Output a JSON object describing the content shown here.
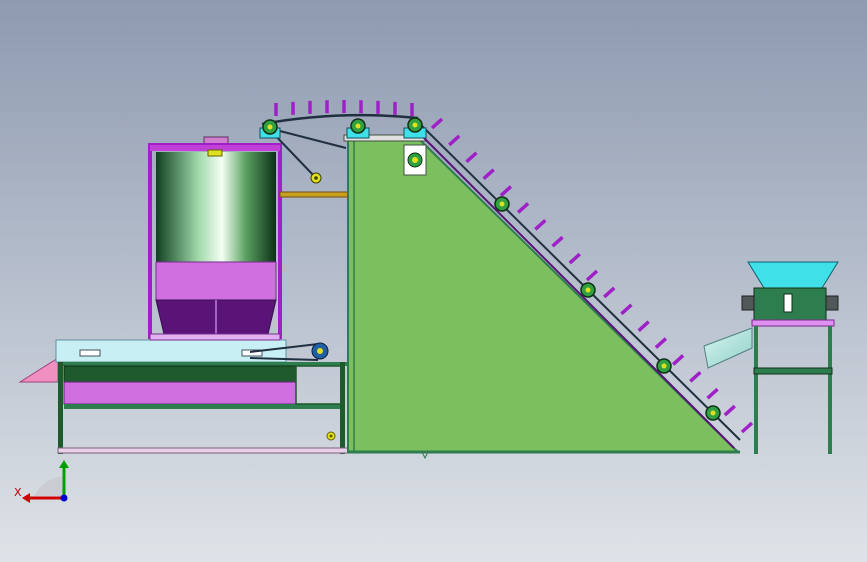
{
  "viewport": {
    "background_top": "#8d9ab0",
    "background_bottom": "#dfe3e8"
  },
  "triad": {
    "x_label": "X",
    "x_color": "#d00000",
    "y_color": "#00a000",
    "z_color": "#0000d0"
  },
  "colors": {
    "frame_green": "#2e7d4f",
    "incline_fill": "#7bbf5e",
    "purple": "#a020c8",
    "magenta_fill": "#d070e0",
    "dark_purple": "#5a1478",
    "cyan": "#40e0e8",
    "light_cyan": "#c8f0f4",
    "pink": "#f090c0",
    "dark_green": "#1e5a2c",
    "yellow": "#e0e020"
  },
  "parts": {
    "hopper_tank": "tank",
    "incline_conveyor": "incline-conveyor",
    "feed_hopper": "feed-hopper",
    "base_conveyor": "base-conveyor"
  }
}
